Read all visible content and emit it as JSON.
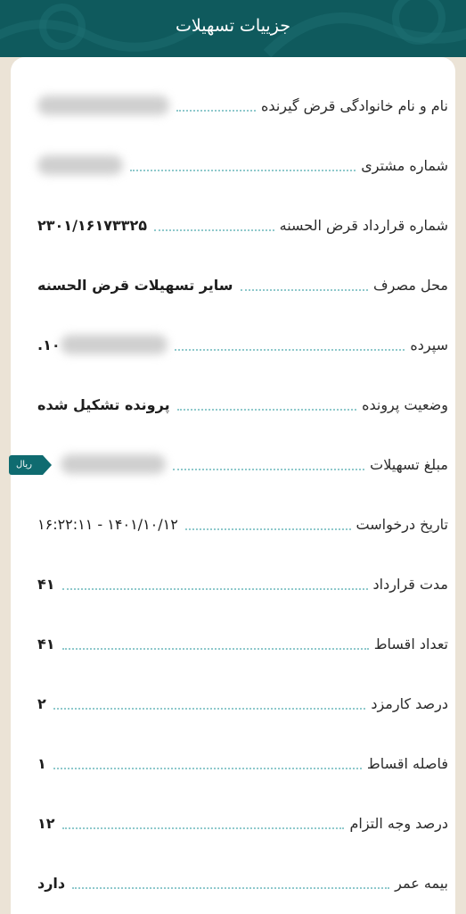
{
  "header": {
    "title": "جزییات تسهیلات"
  },
  "colors": {
    "header_bg": "#0f5a5d",
    "page_bg": "#ebe3d6",
    "dots": "#8fc9cc",
    "badge_bg": "#0f6b70"
  },
  "rows": [
    {
      "label": "نام و نام خانوادگی قرض گیرنده",
      "value": "",
      "redacted": true
    },
    {
      "label": "شماره مشتری",
      "value": "",
      "redacted": true
    },
    {
      "label": "شماره قرارداد قرض الحسنه",
      "value": "۲۳۰۱/۱۶۱۷۳۳۲۵"
    },
    {
      "label": "محل مصرف",
      "value": "سایر تسهیلات قرض الحسنه"
    },
    {
      "label": "سپرده",
      "value": "۱۰.",
      "redacted": true
    },
    {
      "label": "وضعیت پرونده",
      "value": "پرونده تشکیل شده"
    },
    {
      "label": "مبلغ تسهیلات",
      "value": "",
      "redacted": true,
      "badge": "ریال"
    },
    {
      "label": "تاریخ درخواست",
      "value": "۱۴۰۱/۱۰/۱۲ - ۱۶:۲۲:۱۱"
    },
    {
      "label": "مدت قرارداد",
      "value": "۴۱"
    },
    {
      "label": "تعداد اقساط",
      "value": "۴۱"
    },
    {
      "label": "درصد کارمزد",
      "value": "۲"
    },
    {
      "label": "فاصله اقساط",
      "value": "۱"
    },
    {
      "label": "درصد وجه التزام",
      "value": "۱۲"
    },
    {
      "label": "بیمه عمر",
      "value": "دارد"
    }
  ]
}
